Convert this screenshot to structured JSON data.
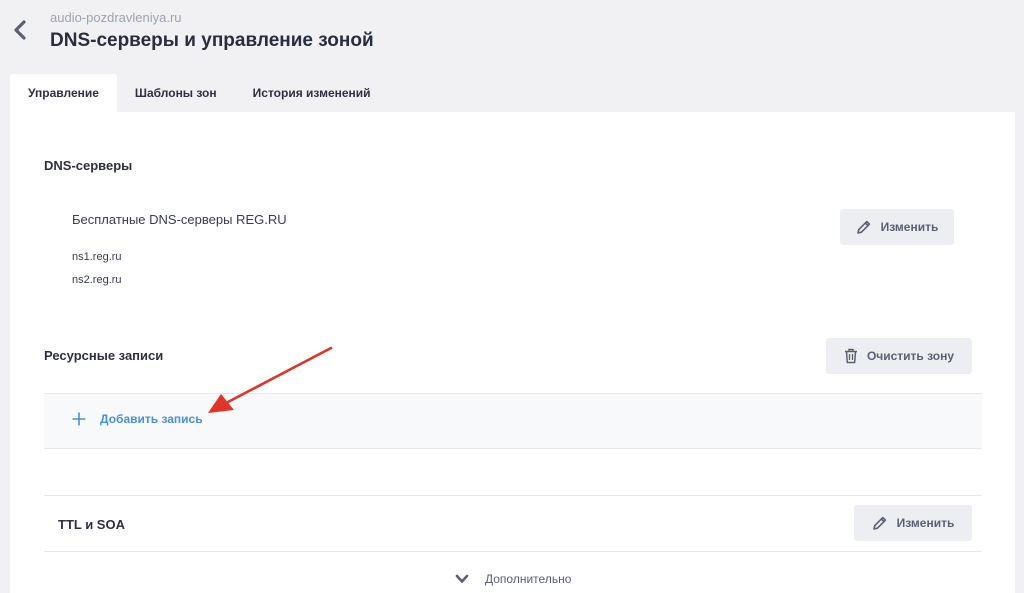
{
  "header": {
    "domain": "audio-pozdravleniya.ru",
    "title": "DNS-серверы и управление зоной"
  },
  "tabs": [
    {
      "label": "Управление",
      "active": true
    },
    {
      "label": "Шаблоны зон",
      "active": false
    },
    {
      "label": "История изменений",
      "active": false
    }
  ],
  "dns_servers": {
    "title": "DNS-серверы",
    "provider": "Бесплатные DNS-серверы REG.RU",
    "servers": [
      "ns1.reg.ru",
      "ns2.reg.ru"
    ],
    "edit_label": "Изменить"
  },
  "resource_records": {
    "title": "Ресурсные записи",
    "clear_label": "Очистить зону",
    "add_label": "Добавить запись"
  },
  "ttl_soa": {
    "title": "TTL и SOA",
    "edit_label": "Изменить"
  },
  "more_label": "Дополнительно",
  "colors": {
    "background": "#f1f1f4",
    "panel": "#ffffff",
    "link": "#4a90d6",
    "annotation_arrow": "#e0342b",
    "button_bg": "#eceef2"
  },
  "icons": {
    "back": "chevron-left-icon",
    "edit": "pencil-icon",
    "clear": "trash-icon",
    "add": "plus-icon",
    "more": "chevron-down-icon"
  }
}
